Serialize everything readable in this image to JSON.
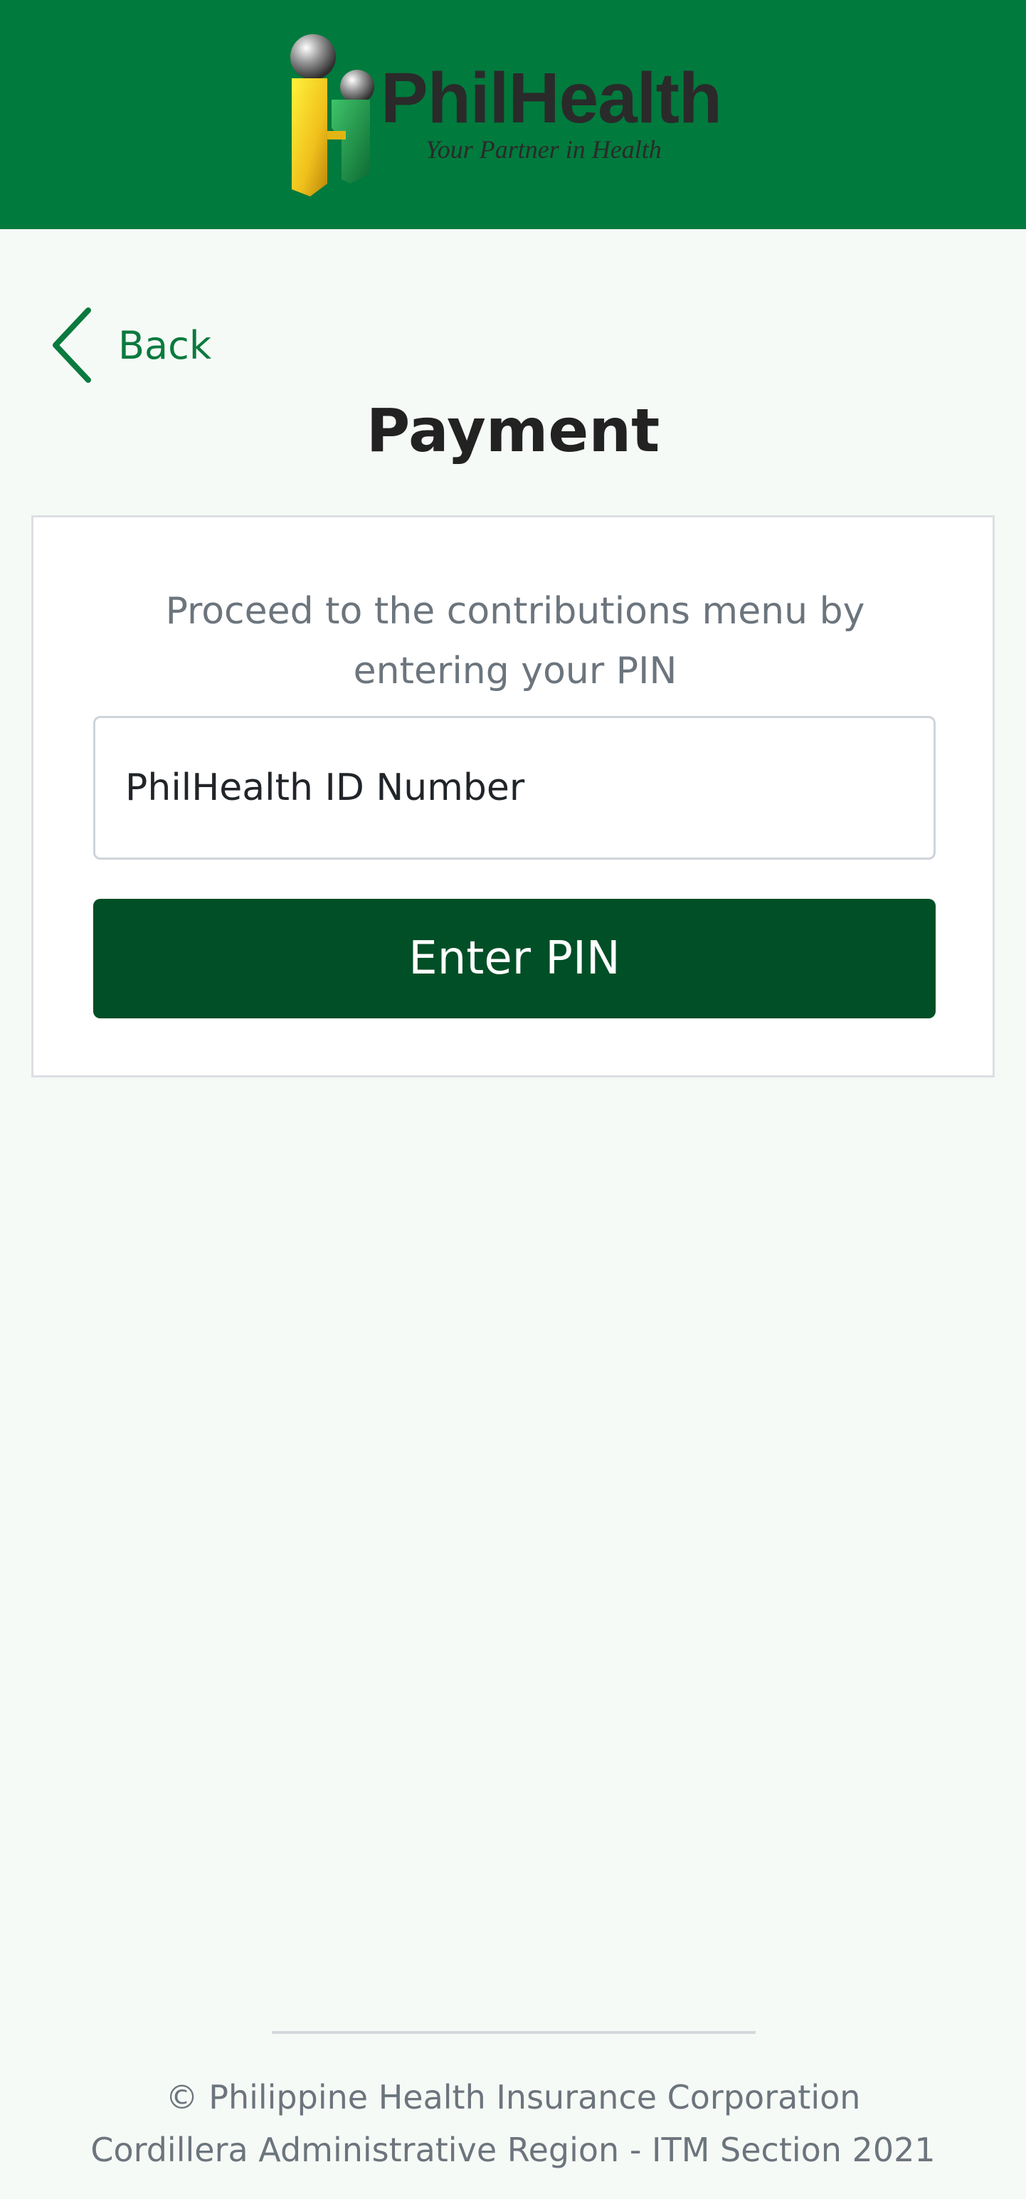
{
  "header": {
    "logo": {
      "name": "PhilHealth",
      "tagline": "Your Partner in Health",
      "icon": "philhealth-logo-icon"
    },
    "colors": {
      "header_bg": "#007a3d"
    }
  },
  "nav": {
    "back_label": "Back",
    "back_icon": "chevron-left-icon"
  },
  "page": {
    "title": "Payment"
  },
  "form": {
    "instruction": "Proceed to the contributions menu by entering your PIN",
    "pin_field": {
      "placeholder": "PhilHealth ID Number",
      "value": ""
    },
    "submit_label": "Enter PIN",
    "colors": {
      "button_bg": "#014f26",
      "accent": "#0a7a3e"
    }
  },
  "footer": {
    "line1": "© Philippine Health Insurance Corporation",
    "line2": "Cordillera Administrative Region - ITM Section 2021"
  }
}
